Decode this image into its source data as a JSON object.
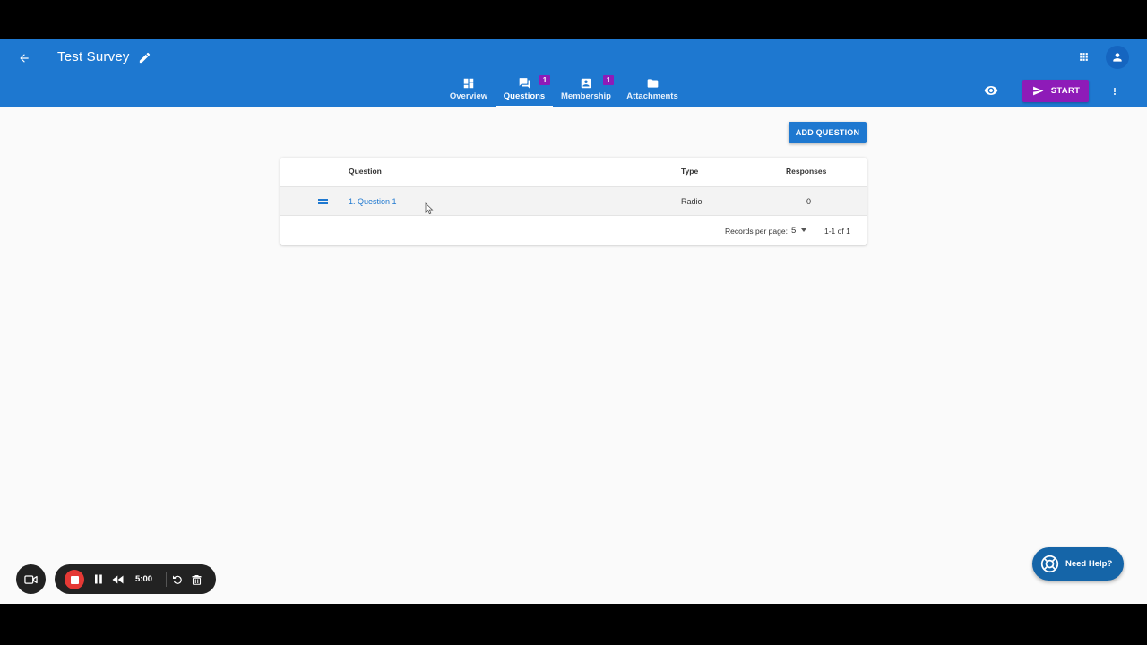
{
  "header": {
    "title": "Test Survey"
  },
  "tabs": [
    {
      "label": "Overview",
      "badge": null,
      "icon": "dashboard-icon",
      "active": false
    },
    {
      "label": "Questions",
      "badge": "1",
      "icon": "forum-icon",
      "active": true
    },
    {
      "label": "Membership",
      "badge": "1",
      "icon": "contact-card-icon",
      "active": false
    },
    {
      "label": "Attachments",
      "badge": null,
      "icon": "folder-icon",
      "active": false
    }
  ],
  "actions": {
    "start_label": "START",
    "add_question_label": "ADD QUESTION"
  },
  "table": {
    "headers": {
      "question": "Question",
      "type": "Type",
      "responses": "Responses"
    },
    "rows": [
      {
        "question": "1. Question 1",
        "type": "Radio",
        "responses": "0"
      }
    ],
    "footer": {
      "records_per_page_label": "Records per page:",
      "records_per_page_value": "5",
      "range": "1-1 of 1"
    }
  },
  "recorder": {
    "time": "5:00"
  },
  "help": {
    "label": "Need Help?"
  },
  "colors": {
    "primary": "#1e78d0",
    "accent": "#8e1bb8",
    "recorder_stop": "#e53935",
    "help_button": "#1565a8"
  }
}
